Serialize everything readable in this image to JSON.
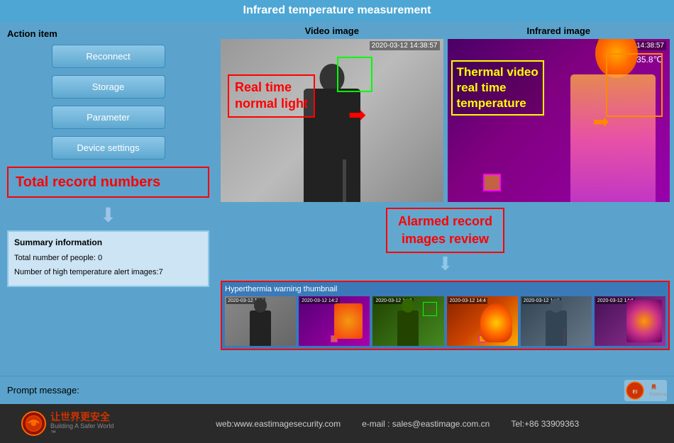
{
  "title": "Infrared temperature measurement",
  "left_panel": {
    "action_item_label": "Action item",
    "buttons": [
      {
        "label": "Reconnect",
        "name": "reconnect-button"
      },
      {
        "label": "Storage",
        "name": "storage-button"
      },
      {
        "label": "Parameter",
        "name": "parameter-button"
      },
      {
        "label": "Device settings",
        "name": "device-settings-button"
      }
    ],
    "total_record_label": "Total record numbers",
    "summary": {
      "title": "Summary information",
      "people_label": "Total number of people:  0",
      "alert_label": "Number of high temperature alert images:7"
    }
  },
  "video_section": {
    "video_image_label": "Video image",
    "infrared_image_label": "Infrared image",
    "normal_timestamp": "2020-03-12 14:38:57",
    "thermal_timestamp": "2020-03-12 14:38:57",
    "thermal_temp": "35.8℃",
    "real_time_label": "Real time\nnormal light",
    "thermal_label": "Thermal video\nreal time\ntemperature",
    "alarmed_label": "Alarmed record\nimages review",
    "thumbnails_label": "Hyperthermia warning thumbnail",
    "thumbnails": [
      {
        "id": "thumb1",
        "timestamp": "2020-03-12 14:1"
      },
      {
        "id": "thumb2",
        "timestamp": "2020-03-12 14:2"
      },
      {
        "id": "thumb3",
        "timestamp": "2020-03-12 14:3"
      },
      {
        "id": "thumb4",
        "timestamp": "2020-03-12 14:4"
      },
      {
        "id": "thumb5",
        "timestamp": "2020-03-12 14:5"
      },
      {
        "id": "thumb6",
        "timestamp": "2020-03-12 14:6"
      }
    ]
  },
  "prompt": {
    "label": "Prompt message:"
  },
  "footer": {
    "web": "web:www.eastimagesecurity.com",
    "email": "e-mail : sales@eastimage.com.cn",
    "tel": "Tel:+86 33909363",
    "logo_line1": "让世界更安全",
    "logo_sub": "Building A Safer World",
    "eastimage": "Eastimage"
  }
}
